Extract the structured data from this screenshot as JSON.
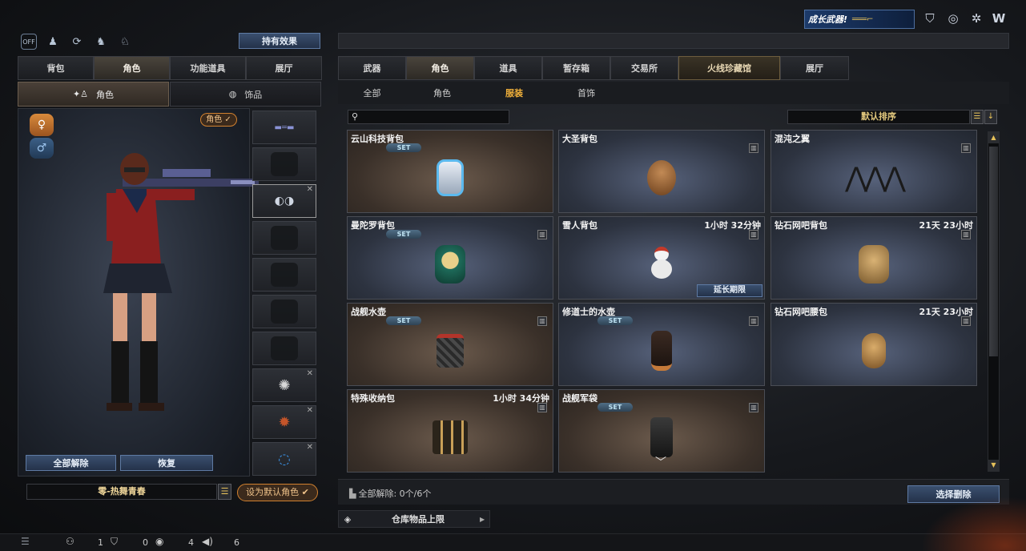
{
  "top_banner": {
    "text": "成长武器!"
  },
  "left": {
    "effect_button": "持有效果",
    "tabs": [
      "背包",
      "角色",
      "功能道具",
      "展厅"
    ],
    "active_tab": 1,
    "sub_tabs": [
      "角色",
      "饰品"
    ],
    "char_badge": "角色 ✓",
    "clear_all": "全部解除",
    "restore": "恢复",
    "preset_name": "零-热舞青春",
    "set_default": "设为默认角色"
  },
  "right": {
    "tabs": [
      "武器",
      "角色",
      "道具",
      "暂存箱",
      "交易所",
      "火线珍藏馆",
      "展厅"
    ],
    "active_tab": 1,
    "sub_tabs": [
      "全部",
      "角色",
      "服装",
      "首饰"
    ],
    "active_sub_tab": 2,
    "search_placeholder": "",
    "sort_label": "默认排序",
    "items": [
      {
        "name": "云山科技背包",
        "time": "",
        "set": "SET",
        "warm": true
      },
      {
        "name": "大圣背包",
        "time": "",
        "set": "",
        "warm": false
      },
      {
        "name": "混沌之翼",
        "time": "",
        "set": "",
        "warm": false
      },
      {
        "name": "曼陀罗背包",
        "time": "",
        "set": "SET",
        "warm": false
      },
      {
        "name": "雪人背包",
        "time": "1小时 32分钟",
        "set": "",
        "warm": false,
        "extend": "延长期限"
      },
      {
        "name": "钻石网吧背包",
        "time": "21天 23小时",
        "set": "",
        "warm": false
      },
      {
        "name": "战舰水壶",
        "time": "",
        "set": "SET",
        "warm": true
      },
      {
        "name": "修道士的水壶",
        "time": "",
        "set": "SET",
        "warm": false
      },
      {
        "name": "钻石网吧腰包",
        "time": "21天 23小时",
        "set": "",
        "warm": false
      },
      {
        "name": "特殊收纳包",
        "time": "1小时 34分钟",
        "set": "",
        "warm": true
      },
      {
        "name": "战舰军袋",
        "time": "",
        "set": "SET",
        "warm": true
      }
    ],
    "clear_status": "全部解除: 0个/6个",
    "select_remove": "选择删除",
    "warehouse_limit": "仓库物品上限"
  },
  "footer": {
    "count1": "1",
    "count2": "0",
    "count3": "4",
    "count4": "6"
  }
}
